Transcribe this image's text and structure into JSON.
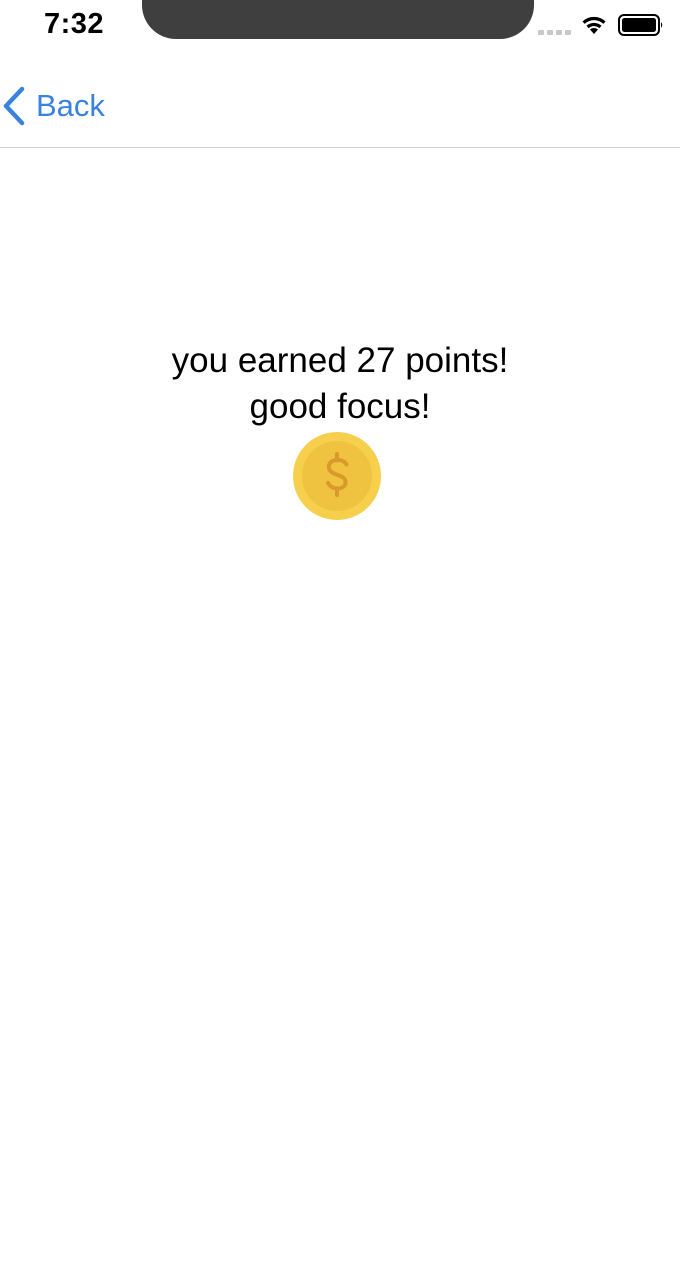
{
  "status_bar": {
    "time": "7:32"
  },
  "nav": {
    "back_label": "Back"
  },
  "result": {
    "line1": "you earned 27 points!",
    "line2": "good focus!"
  },
  "icons": {
    "back": "chevron-left-icon",
    "coin": "dollar-coin-icon",
    "wifi": "wifi-icon",
    "battery": "battery-icon",
    "signal": "cellular-signal-icon"
  },
  "colors": {
    "accent": "#3a82e0",
    "coin_outer": "#f6d04d",
    "coin_inner": "#efbf3a",
    "coin_symbol": "#d99a2b",
    "notch": "#3f3f3f"
  }
}
